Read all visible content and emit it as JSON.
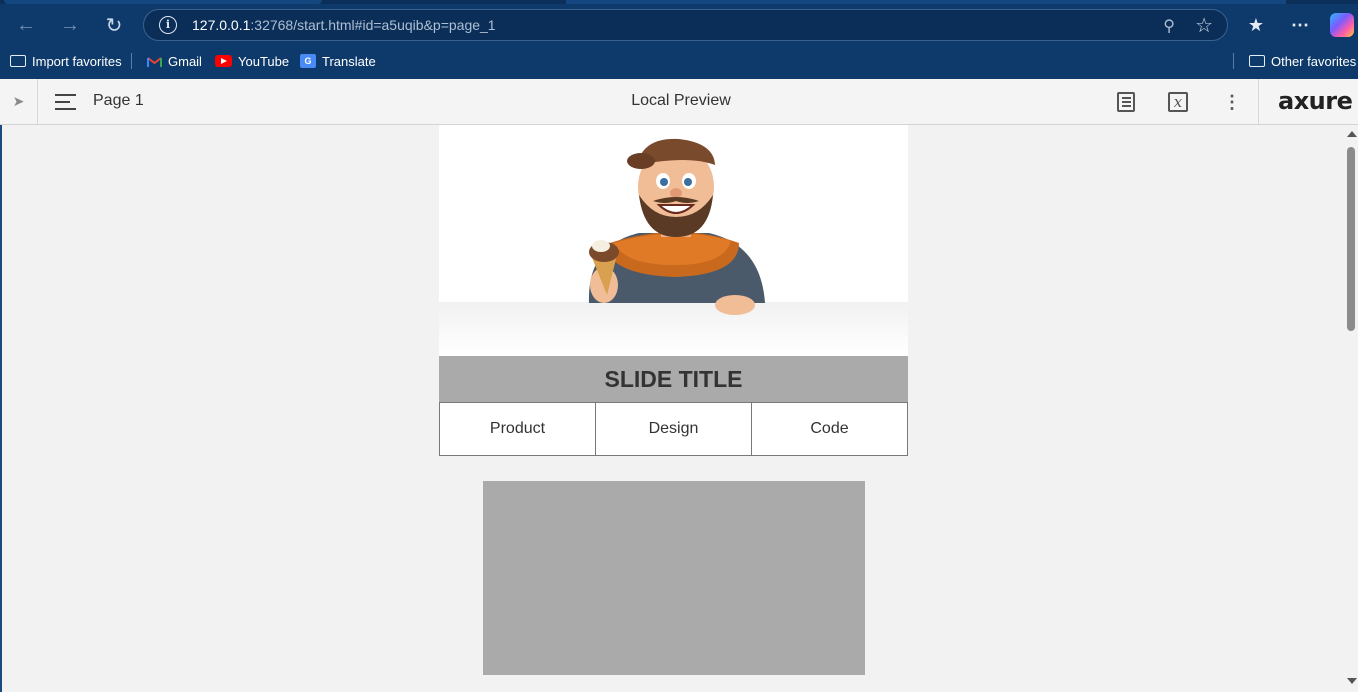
{
  "browser": {
    "url_host": "127.0.0.1",
    "url_rest": ":32768/start.html#id=a5uqib&p=page_1",
    "bookmarks": [
      {
        "label": "Import favorites",
        "icon": "folder-icon"
      },
      {
        "label": "Gmail",
        "icon": "gmail-icon"
      },
      {
        "label": "YouTube",
        "icon": "youtube-icon"
      },
      {
        "label": "Translate",
        "icon": "translate-icon"
      }
    ],
    "other_favorites": "Other favorites"
  },
  "axure": {
    "page_name": "Page 1",
    "title": "Local Preview",
    "logo": "axure"
  },
  "slide": {
    "title": "SLIDE TITLE",
    "tabs": [
      "Product",
      "Design",
      "Code"
    ]
  },
  "colors": {
    "chrome": "#0e3a6b",
    "slide_title_bg": "#aaaaaa",
    "placeholder_box": "#aaaaaa"
  }
}
